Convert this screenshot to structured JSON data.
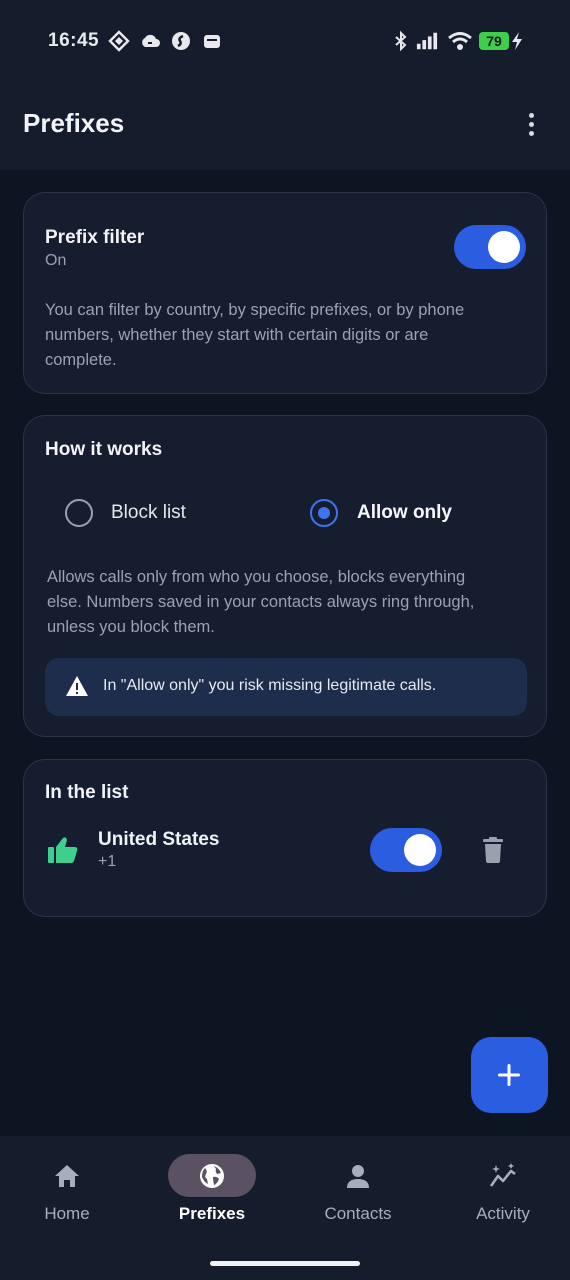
{
  "status_bar": {
    "time": "16:45",
    "battery": "79"
  },
  "header": {
    "title": "Prefixes"
  },
  "prefix_filter": {
    "title": "Prefix filter",
    "state": "On",
    "enabled": true,
    "description_lines": [
      "You can filter by country, by specific prefixes, or by phone",
      "numbers, whether they start with certain digits or are",
      "complete."
    ]
  },
  "how_it_works": {
    "title": "How it works",
    "options": [
      {
        "label": "Block list",
        "selected": false
      },
      {
        "label": "Allow only",
        "selected": true
      }
    ],
    "description_lines": [
      "Allows calls only from who you choose, blocks everything",
      "else. Numbers saved in your contacts always ring through,",
      "unless you block them."
    ],
    "warning": "In \"Allow only\" you risk missing legitimate calls."
  },
  "in_the_list": {
    "title": "In the list",
    "items": [
      {
        "name": "United States",
        "code": "+1",
        "enabled": true,
        "icon": "thumbs-up-icon",
        "icon_color": "#3ecf8e"
      }
    ]
  },
  "fab": {
    "icon": "plus-icon"
  },
  "bottom_nav": {
    "items": [
      {
        "label": "Home",
        "icon": "home-icon",
        "active": false
      },
      {
        "label": "Prefixes",
        "icon": "globe-icon",
        "active": true
      },
      {
        "label": "Contacts",
        "icon": "person-icon",
        "active": false
      },
      {
        "label": "Activity",
        "icon": "activity-icon",
        "active": false
      }
    ]
  },
  "colors": {
    "background": "#0d1422",
    "card": "#151d2e",
    "accent": "#2a5de0",
    "radio_selected": "#3f74f0",
    "warning_bg": "#1f2d4d",
    "nav_active_pill": "#5a5262"
  }
}
